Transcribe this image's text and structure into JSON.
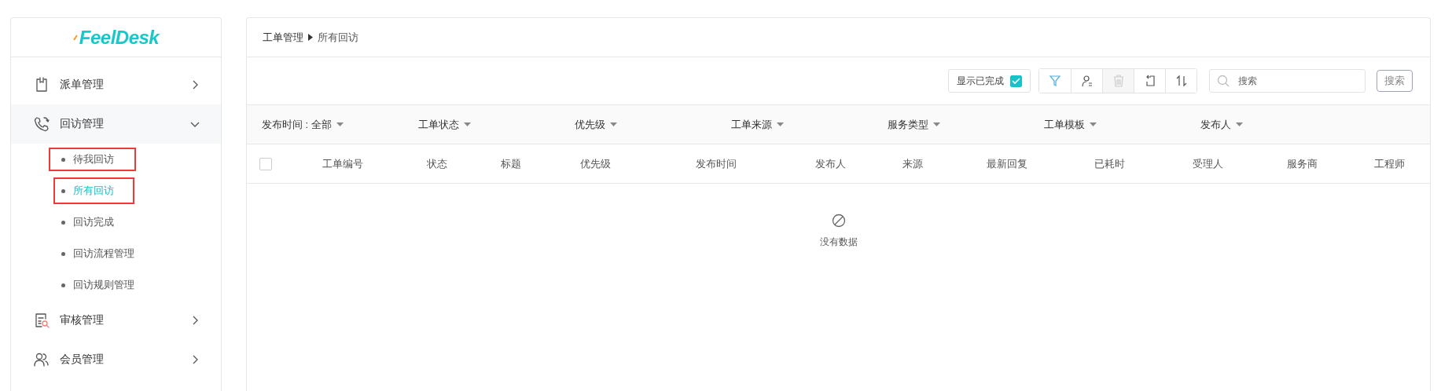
{
  "sidebar": {
    "logo": "FeelDesk",
    "items": [
      {
        "label": "派单管理",
        "kind": "clipboard",
        "expanded": false
      },
      {
        "label": "回访管理",
        "kind": "phone",
        "expanded": true,
        "children": [
          {
            "label": "待我回访",
            "selected": false,
            "annotated": true
          },
          {
            "label": "所有回访",
            "selected": true,
            "annotated": true
          },
          {
            "label": "回访完成",
            "selected": false,
            "annotated": false
          },
          {
            "label": "回访流程管理",
            "selected": false,
            "annotated": false
          },
          {
            "label": "回访规则管理",
            "selected": false,
            "annotated": false
          }
        ]
      },
      {
        "label": "审核管理",
        "kind": "review",
        "expanded": false
      },
      {
        "label": "会员管理",
        "kind": "users",
        "expanded": false
      }
    ]
  },
  "breadcrumb": [
    "工单管理",
    "所有回访"
  ],
  "toolbar": {
    "show_completed": {
      "label": "显示已完成",
      "checked": true
    },
    "tools": [
      {
        "kind": "filter",
        "disabled": false
      },
      {
        "kind": "assign",
        "disabled": false
      },
      {
        "kind": "delete",
        "disabled": true
      },
      {
        "kind": "export",
        "disabled": false
      },
      {
        "kind": "sort",
        "disabled": false
      }
    ],
    "search": {
      "placeholder": "搜索"
    },
    "search_button": "搜索"
  },
  "filters": [
    "发布时间 : 全部",
    "工单状态",
    "优先级",
    "工单来源",
    "服务类型",
    "工单模板",
    "发布人"
  ],
  "table": {
    "select_all": {
      "checked": false
    },
    "columns": [
      "工单编号",
      "状态",
      "标题",
      "优先级",
      "发布时间",
      "发布人",
      "来源",
      "最新回复",
      "已耗时",
      "受理人",
      "服务商",
      "工程师"
    ],
    "empty_text": "没有数据"
  }
}
